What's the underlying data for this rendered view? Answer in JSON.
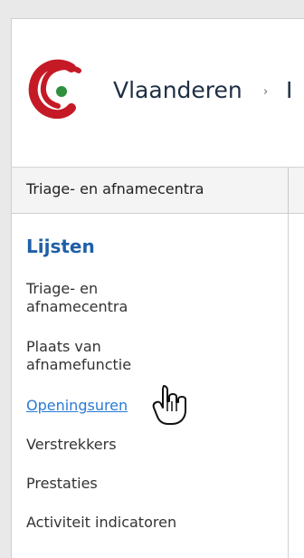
{
  "header": {
    "brand": "Vlaanderen",
    "separator": "›",
    "next_crumb": "I"
  },
  "subbar": {
    "current_page": "Triage- en afnamecentra"
  },
  "sidebar": {
    "title": "Lijsten",
    "items": [
      {
        "label": "Triage- en\nafnamecentra"
      },
      {
        "label": "Plaats van\nafnamefunctie"
      },
      {
        "label": "Openingsuren"
      },
      {
        "label": "Verstrekkers"
      },
      {
        "label": "Prestaties"
      },
      {
        "label": "Activiteit indicatoren"
      }
    ]
  },
  "colors": {
    "brand_red": "#c51a25",
    "brand_green": "#2f8f3b",
    "section_blue": "#1f5fa8",
    "link_blue": "#2a7ad5"
  },
  "icons": {
    "logo": "vlaanderen-logo",
    "cursor": "hand-pointer-icon"
  }
}
